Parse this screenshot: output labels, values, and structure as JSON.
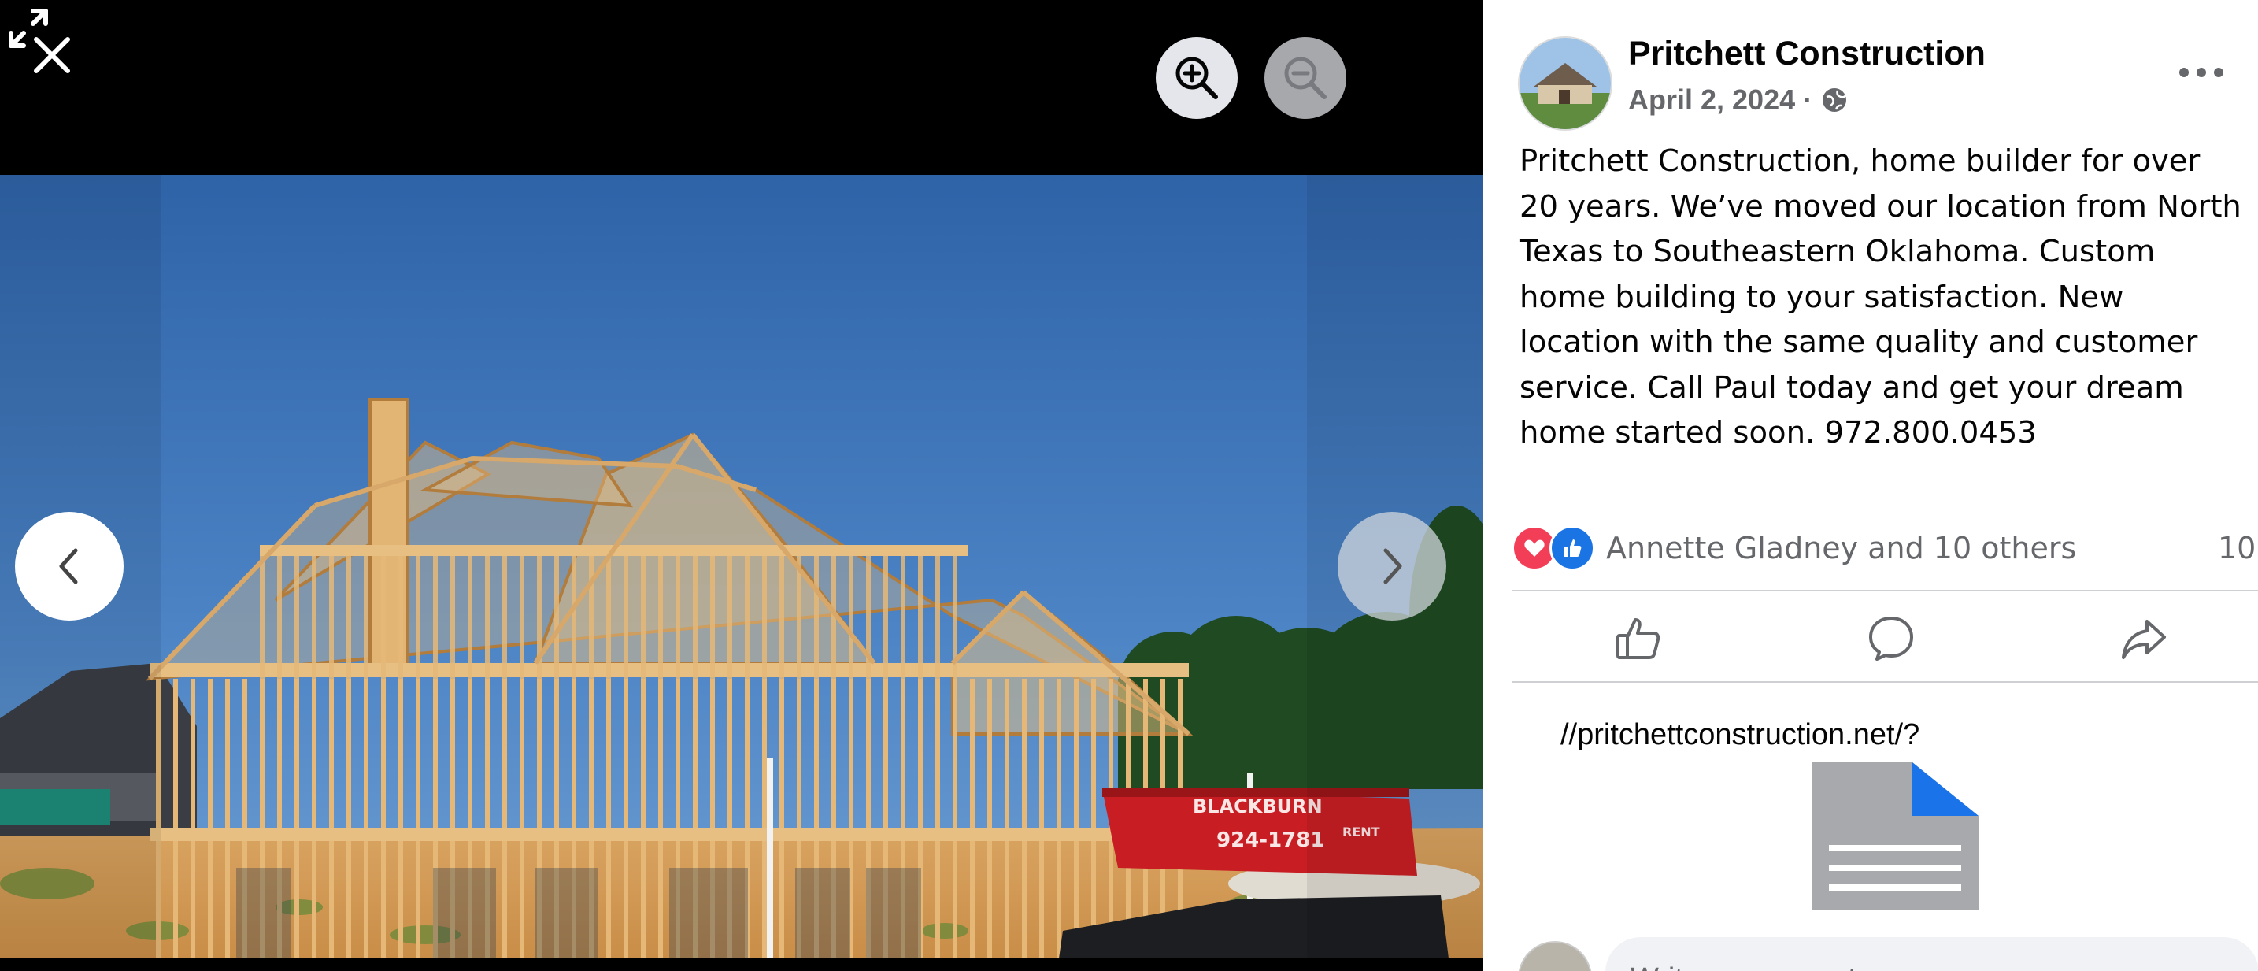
{
  "viewer": {
    "close_icon": "close-icon",
    "zoom_in_icon": "zoom-in-icon",
    "zoom_out_icon": "zoom-out-icon",
    "fullscreen_icon": "fullscreen-icon",
    "prev_icon": "chevron-left-icon",
    "next_icon": "chevron-right-icon",
    "dumpster_brand": "BLACKBURN",
    "dumpster_phone": "924-1781",
    "dumpster_tag": "RENT"
  },
  "post": {
    "author": "Pritchett Construction",
    "date": "April 2, 2024 ·",
    "privacy_icon": "globe-icon",
    "text": "Pritchett Construction, home builder for over 20 years. We’ve moved our location from North Texas to Southeastern Oklahoma. Custom home building to your satisfaction. New location with the same quality and customer service. Call Paul today and get your dream home started soon. 972.800.0453",
    "reactions": {
      "icons": [
        "love-icon",
        "like-icon"
      ],
      "names": "Annette Gladney and 10 others",
      "count": "10"
    },
    "actions": [
      "like-button",
      "comment-button",
      "share-button"
    ],
    "link": "//pritchettconstruction.net/?",
    "comment_placeholder": "Write a comment..."
  },
  "colors": {
    "love": "#f33e58",
    "like": "#1b74e4",
    "secondary_text": "#65676b"
  }
}
